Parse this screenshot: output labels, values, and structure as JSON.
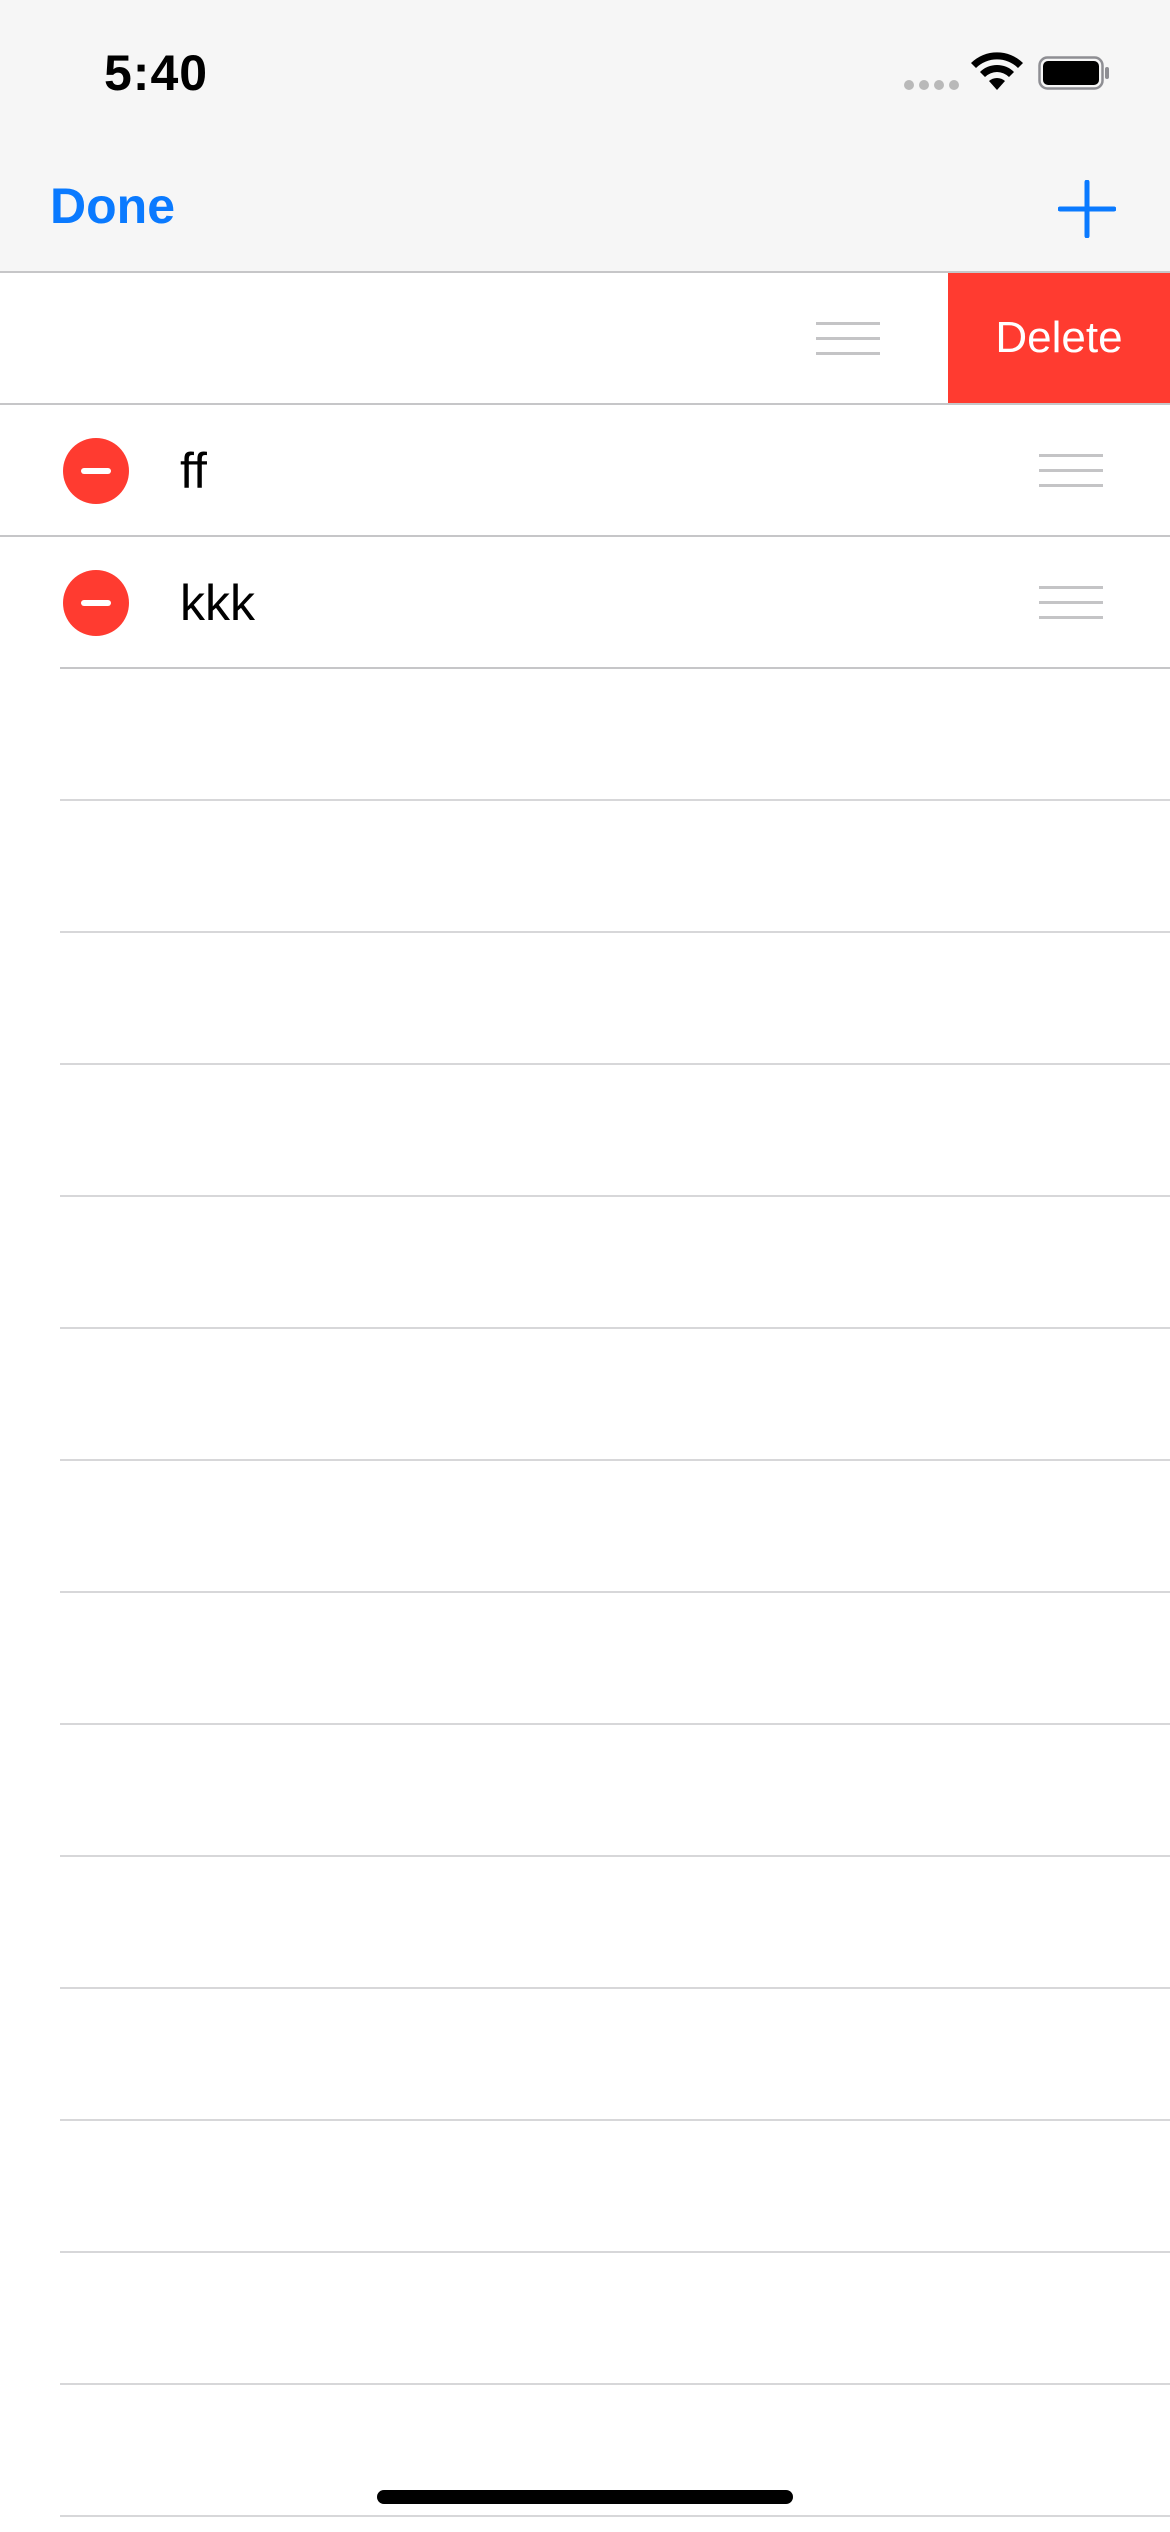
{
  "status_bar": {
    "time": "5:40",
    "icons": [
      "cellular-signal-icon",
      "wifi-icon",
      "battery-icon"
    ]
  },
  "nav_bar": {
    "done_label": "Done",
    "add_icon": "plus-icon"
  },
  "rows": [
    {
      "label": "",
      "state": "swiped",
      "action_label": "Delete"
    },
    {
      "label": "ff",
      "state": "editing"
    },
    {
      "label": "kkk",
      "state": "editing"
    }
  ],
  "colors": {
    "accent": "#0a7aff",
    "destructive": "#ff3b30",
    "separator": "#c6c6c8",
    "bar_background": "#f6f6f6"
  }
}
